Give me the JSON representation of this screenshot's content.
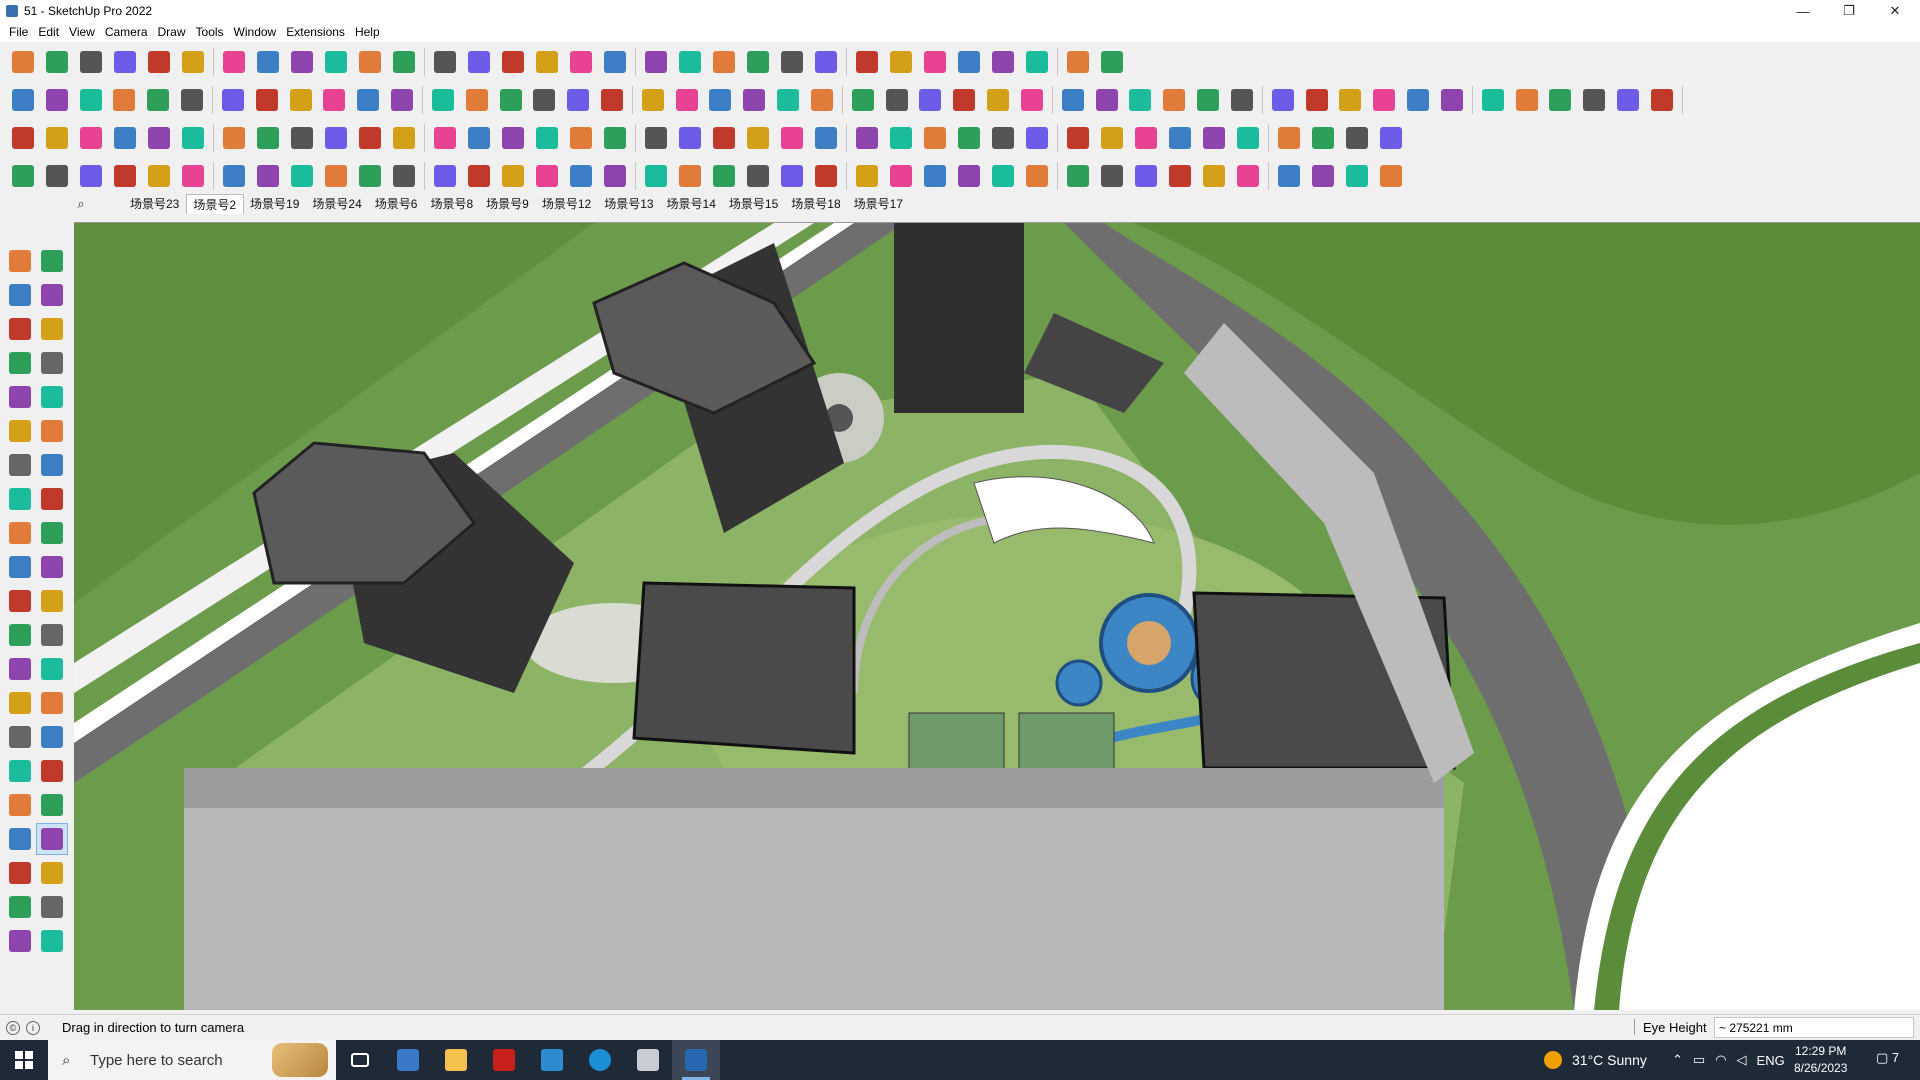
{
  "window": {
    "title": "51 - SketchUp Pro 2022",
    "controls": {
      "minimize": "—",
      "maximize": "❐",
      "close": "✕"
    }
  },
  "menu": [
    "File",
    "Edit",
    "View",
    "Camera",
    "Draw",
    "Tools",
    "Window",
    "Extensions",
    "Help"
  ],
  "toolbars": {
    "row1": [
      "zoom-extents-icon",
      "select-icon",
      "eraser-icon",
      "line-icon",
      "arc-icon",
      "rectangle-icon",
      "push-pull-icon",
      "follow-me-icon",
      "move-icon",
      "rotate-icon",
      "scale-icon",
      "tape-measure-icon",
      "text-icon",
      "paint-bucket-icon",
      "orbit-icon",
      "pan-icon",
      "zoom-icon",
      "zoom-window-icon",
      "sandbox-icon",
      "smoove-icon",
      "stamp-icon",
      "drape-icon",
      "warehouse-icon",
      "extension-icon",
      "layout-icon",
      "style-icon",
      "section-icon",
      "flip-icon",
      "cleanup-icon",
      "undo-icon",
      "redo-icon",
      "hand-icon"
    ],
    "row2_count": 48,
    "row3_count": 40,
    "row4_count": 40
  },
  "scenes": {
    "tabs": [
      "场景号23",
      "场景号2",
      "场景号19",
      "场景号24",
      "场景号6",
      "场景号8",
      "场景号9",
      "场景号12",
      "场景号13",
      "场景号14",
      "场景号15",
      "场景号18",
      "场景号17"
    ],
    "active_index": 1
  },
  "palette_icons": [
    [
      "select-icon",
      "orbit-icon"
    ],
    [
      "paint-bucket-icon",
      "eraser-icon"
    ],
    [
      "component-icon",
      "tag-icon"
    ],
    [
      "line-icon",
      "freehand-icon"
    ],
    [
      "rectangle-icon",
      "rotated-rectangle-icon"
    ],
    [
      "circle-icon",
      "polygon-icon"
    ],
    [
      "arc-icon",
      "two-point-arc-icon"
    ],
    [
      "three-point-arc-icon",
      "pie-icon"
    ],
    [
      "move-icon",
      "push-pull-icon"
    ],
    [
      "rotate-icon",
      "follow-me-icon"
    ],
    [
      "scale-icon",
      "offset-icon"
    ],
    [
      "tape-measure-icon",
      "dimension-icon"
    ],
    [
      "protractor-icon",
      "text-icon"
    ],
    [
      "axes-icon",
      "3d-text-icon"
    ],
    [
      "orbit-icon",
      "pan-icon"
    ],
    [
      "zoom-icon",
      "zoom-window-icon"
    ],
    [
      "zoom-extents-icon",
      "previous-view-icon"
    ],
    [
      "walk-icon",
      "look-around-icon"
    ],
    [
      "position-camera-icon",
      "section-plane-icon"
    ],
    [
      "sandbox-from-contours-icon",
      "sandbox-scratch-icon"
    ],
    [
      "smoove-icon",
      "stamp-icon"
    ]
  ],
  "status": {
    "message": "Drag in direction to turn camera",
    "eye_height_label": "Eye Height",
    "eye_height_value": "~ 275221 mm"
  },
  "taskbar": {
    "search_placeholder": "Type here to search",
    "weather": "31°C  Sunny",
    "language": "ENG",
    "time": "12:29 PM",
    "date": "8/26/2023",
    "notification_count": "7"
  },
  "colors": {
    "grass": "#6b9b4b",
    "road": "#6e6e6e",
    "building": "#4a4a4a",
    "water": "#3d86c6"
  }
}
